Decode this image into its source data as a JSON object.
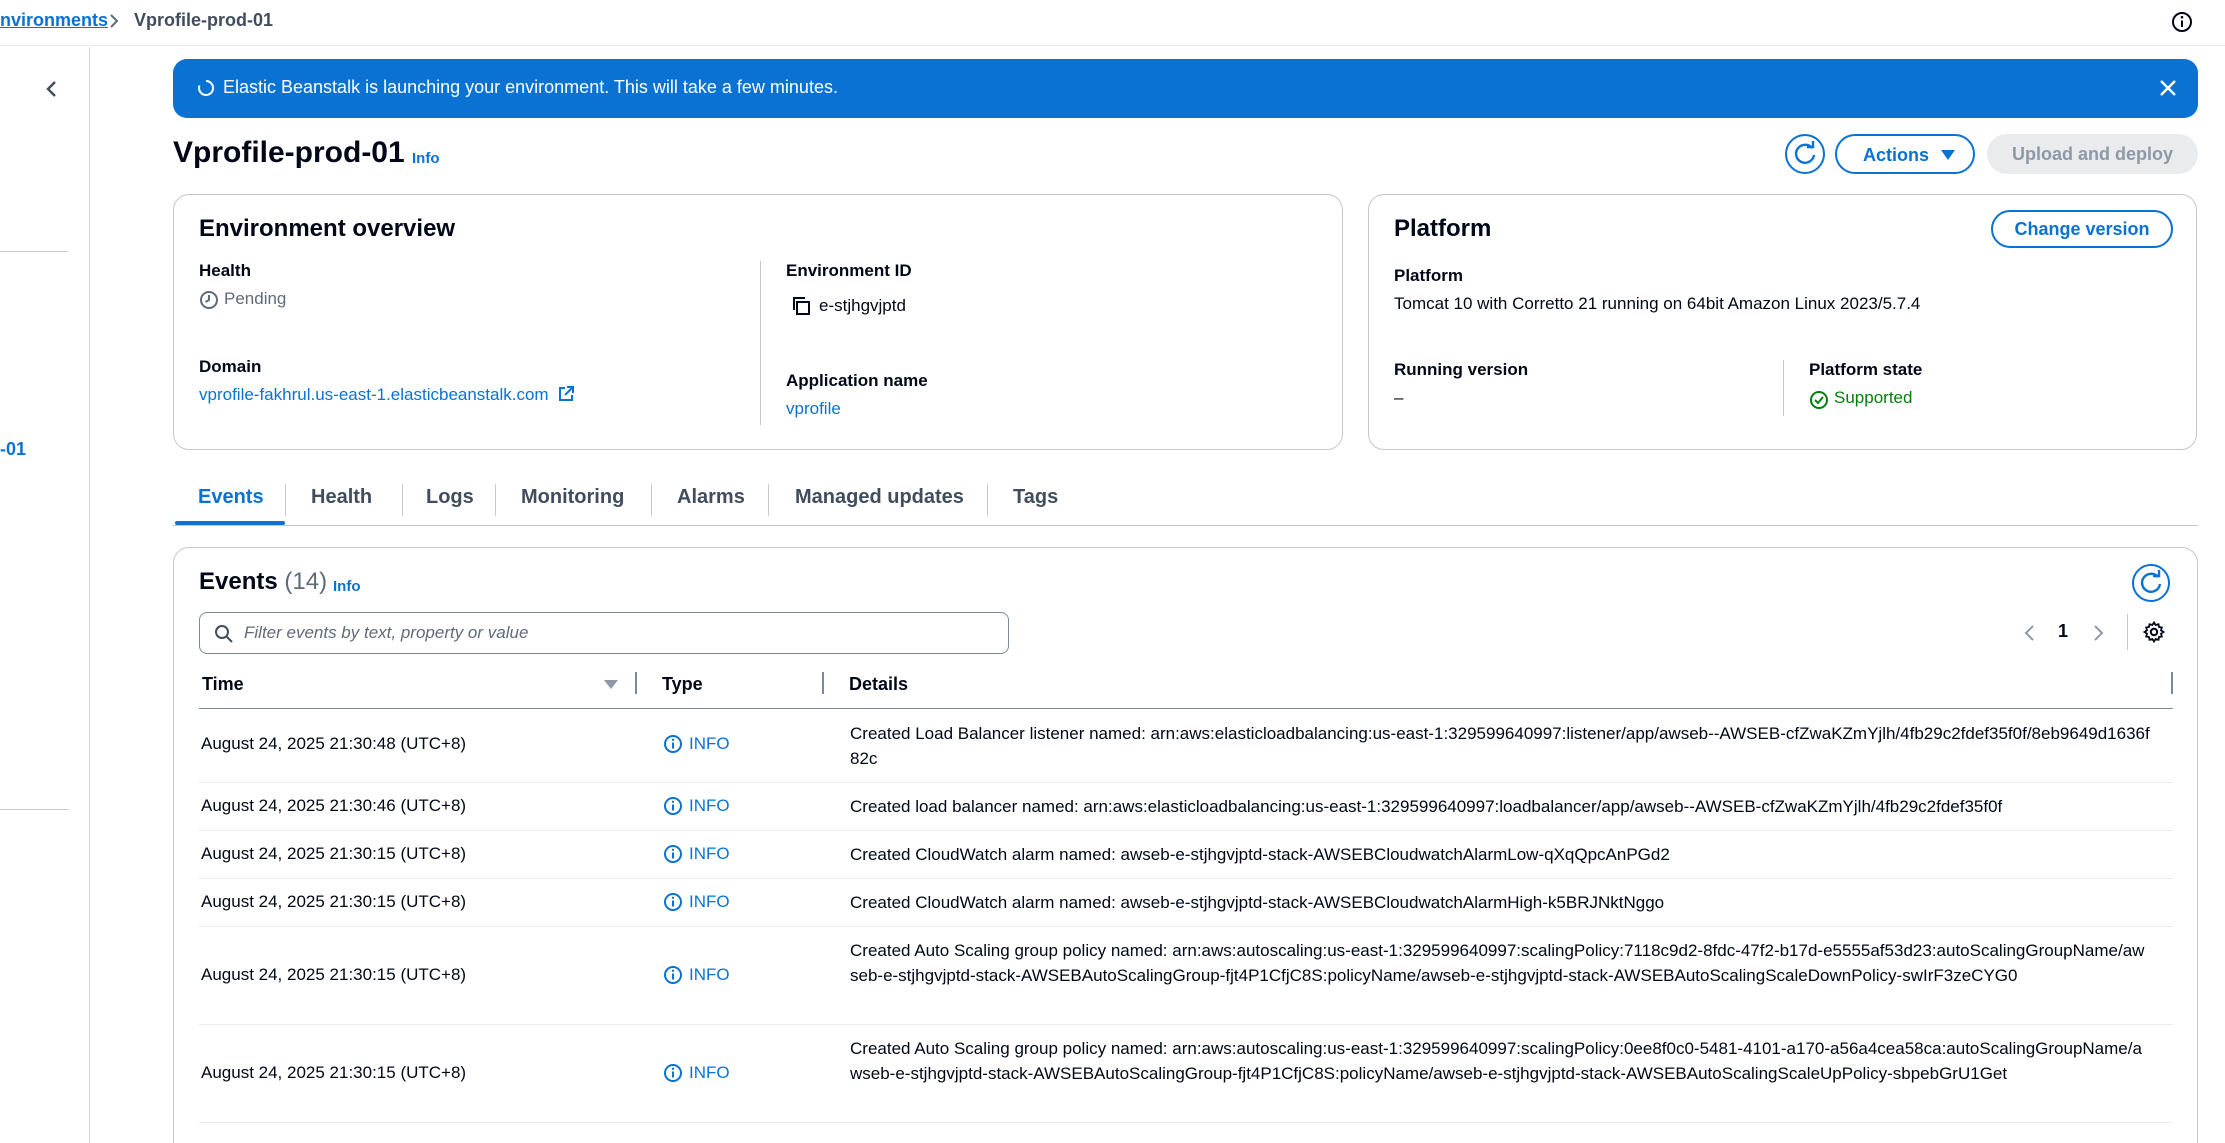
{
  "breadcrumb": {
    "parent": "nvironments",
    "current": "Vprofile-prod-01"
  },
  "nav": {
    "item": "-01"
  },
  "flash": {
    "message": "Elastic Beanstalk is launching your environment. This will take a few minutes."
  },
  "header": {
    "title": "Vprofile-prod-01",
    "info": "Info",
    "actions_label": "Actions",
    "upload_label": "Upload and deploy"
  },
  "overview": {
    "title": "Environment overview",
    "health_label": "Health",
    "health_value": "Pending",
    "domain_label": "Domain",
    "domain_value": "vprofile-fakhrul.us-east-1.elasticbeanstalk.com",
    "env_id_label": "Environment ID",
    "env_id_value": "e-stjhgvjptd",
    "app_name_label": "Application name",
    "app_name_value": "vprofile"
  },
  "platform": {
    "title": "Platform",
    "change_label": "Change version",
    "platform_label": "Platform",
    "platform_value": "Tomcat 10 with Corretto 21 running on 64bit Amazon Linux 2023/5.7.4",
    "running_label": "Running version",
    "running_value": "–",
    "state_label": "Platform state",
    "state_value": "Supported"
  },
  "tabs": [
    "Events",
    "Health",
    "Logs",
    "Monitoring",
    "Alarms",
    "Managed updates",
    "Tags"
  ],
  "events": {
    "title": "Events",
    "count": "(14)",
    "info": "Info",
    "search_placeholder": "Filter events by text, property or value",
    "page": "1",
    "columns": {
      "time": "Time",
      "type": "Type",
      "details": "Details"
    },
    "rows": [
      {
        "time": "August 24, 2025 21:30:48 (UTC+8)",
        "type": "INFO",
        "details": "Created Load Balancer listener named: arn:aws:elasticloadbalancing:us-east-1:329599640997:listener/app/awseb--AWSEB-cfZwaKZmYjlh/4fb29c2fdef35f0f/8eb9649d1636f82c"
      },
      {
        "time": "August 24, 2025 21:30:46 (UTC+8)",
        "type": "INFO",
        "details": "Created load balancer named: arn:aws:elasticloadbalancing:us-east-1:329599640997:loadbalancer/app/awseb--AWSEB-cfZwaKZmYjlh/4fb29c2fdef35f0f"
      },
      {
        "time": "August 24, 2025 21:30:15 (UTC+8)",
        "type": "INFO",
        "details": "Created CloudWatch alarm named: awseb-e-stjhgvjptd-stack-AWSEBCloudwatchAlarmLow-qXqQpcAnPGd2"
      },
      {
        "time": "August 24, 2025 21:30:15 (UTC+8)",
        "type": "INFO",
        "details": "Created CloudWatch alarm named: awseb-e-stjhgvjptd-stack-AWSEBCloudwatchAlarmHigh-k5BRJNktNggo"
      },
      {
        "time": "August 24, 2025 21:30:15 (UTC+8)",
        "type": "INFO",
        "details": "Created Auto Scaling group policy named: arn:aws:autoscaling:us-east-1:329599640997:scalingPolicy:7118c9d2-8fdc-47f2-b17d-e5555af53d23:autoScalingGroupName/awseb-e-stjhgvjptd-stack-AWSEBAutoScalingGroup-fjt4P1CfjC8S:policyName/awseb-e-stjhgvjptd-stack-AWSEBAutoScalingScaleDownPolicy-swIrF3zeCYG0"
      },
      {
        "time": "August 24, 2025 21:30:15 (UTC+8)",
        "type": "INFO",
        "details": "Created Auto Scaling group policy named: arn:aws:autoscaling:us-east-1:329599640997:scalingPolicy:0ee8f0c0-5481-4101-a170-a56a4cea58ca:autoScalingGroupName/awseb-e-stjhgvjptd-stack-AWSEBAutoScalingGroup-fjt4P1CfjC8S:policyName/awseb-e-stjhgvjptd-stack-AWSEBAutoScalingScaleUpPolicy-sbpebGrU1Get"
      }
    ]
  },
  "colors": {
    "accent": "#0972d3",
    "success": "#037f0c",
    "border": "#c6c6cd"
  }
}
